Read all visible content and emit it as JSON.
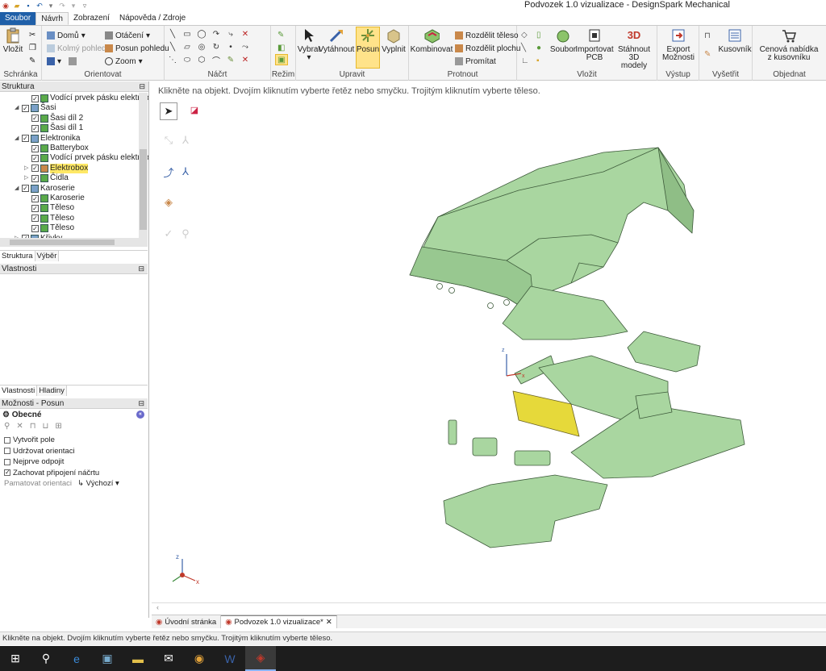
{
  "window": {
    "title": "Podvozek 1.0 vizualizace - DesignSpark Mechanical"
  },
  "ribbon_tabs": [
    "Soubor",
    "Návrh",
    "Zobrazení",
    "Nápověda / Zdroje"
  ],
  "groups": {
    "schranka": {
      "label": "Schránka",
      "paste": "Vložit"
    },
    "orientovat": {
      "label": "Orientovat",
      "home": "Domů",
      "kolmy": "Kolmý pohled",
      "otaceni": "Otáčení",
      "posun_pohledu": "Posun pohledu",
      "zoom": "Zoom"
    },
    "nacrt": {
      "label": "Náčrt"
    },
    "rezim": {
      "label": "Režim"
    },
    "upravit": {
      "label": "Upravit",
      "vybrat": "Vybrat",
      "vytahnout": "Vytáhnout",
      "posun": "Posun",
      "vyplnit": "Vyplnit"
    },
    "protnout": {
      "label": "Protnout",
      "kombinovat": "Kombinovat",
      "rozdelit_teleso": "Rozdělit těleso",
      "rozdelit_plochu": "Rozdělit plochu",
      "promitat": "Promítat"
    },
    "vlozit": {
      "label": "Vložit",
      "soubor": "Soubor",
      "importovat_pcb_1": "Importovat",
      "importovat_pcb_2": "PCB",
      "stahnout_1": "Stáhnout 3D",
      "stahnout_2": "modely"
    },
    "vystup": {
      "label": "Výstup",
      "export_1": "Export",
      "export_2": "Možnosti"
    },
    "vysetrit": {
      "label": "Vyšetřit",
      "kusovnik": "Kusovník"
    },
    "objednat": {
      "label": "Objednat",
      "cenova_1": "Cenová nabídka",
      "cenova_2": "z kusovníku"
    }
  },
  "structure_panel": {
    "title": "Struktura",
    "items": [
      {
        "label": "Vodící prvek pásku elektroboxu",
        "level": 2,
        "expander": "",
        "highlight": false
      },
      {
        "label": "Šasi",
        "level": 1,
        "expander": "◢",
        "highlight": false
      },
      {
        "label": "Šasi díl 2",
        "level": 2,
        "expander": "",
        "highlight": false
      },
      {
        "label": "Šasi díl 1",
        "level": 2,
        "expander": "",
        "highlight": false
      },
      {
        "label": "Elektronika",
        "level": 1,
        "expander": "◢",
        "highlight": false
      },
      {
        "label": "Batterybox",
        "level": 2,
        "expander": "",
        "highlight": false
      },
      {
        "label": "Vodící prvek pásku elektrob",
        "level": 2,
        "expander": "",
        "highlight": false
      },
      {
        "label": "Elektrobox",
        "level": 2,
        "expander": "▷",
        "highlight": true
      },
      {
        "label": "Čidla",
        "level": 2,
        "expander": "▷",
        "highlight": false
      },
      {
        "label": "Karoserie",
        "level": 1,
        "expander": "◢",
        "highlight": false
      },
      {
        "label": "Karoserie",
        "level": 2,
        "expander": "",
        "highlight": false
      },
      {
        "label": "Těleso",
        "level": 2,
        "expander": "",
        "highlight": false
      },
      {
        "label": "Těleso",
        "level": 2,
        "expander": "",
        "highlight": false
      },
      {
        "label": "Těleso",
        "level": 2,
        "expander": "",
        "highlight": false
      },
      {
        "label": "Křivky",
        "level": 1,
        "expander": "▷",
        "highlight": false
      }
    ],
    "tabs": [
      "Struktura",
      "Výběr"
    ]
  },
  "properties_panel": {
    "title": "Vlastnosti",
    "tabs": [
      "Vlastnosti",
      "Hladiny"
    ]
  },
  "options_panel": {
    "title": "Možnosti - Posun",
    "section": "Obecné",
    "options": [
      {
        "label": "Vytvořit pole",
        "checked": false
      },
      {
        "label": "Udržovat orientaci",
        "checked": false
      },
      {
        "label": "Nejprve odpojit",
        "checked": false
      },
      {
        "label": "Zachovat připojení náčrtu",
        "checked": true
      }
    ],
    "remember_label": "Pamatovat orientaci",
    "remember_value": "Výchozí"
  },
  "viewport": {
    "hint": "Klikněte na objekt.  Dvojím kliknutím vyberte řetěz nebo smyčku.  Trojitým kliknutím vyberte těleso."
  },
  "doc_tabs": [
    {
      "label": "Úvodní stránka",
      "active": false
    },
    {
      "label": "Podvozek 1.0 vizualizace*",
      "active": true
    }
  ],
  "status": {
    "text": "Klikněte na objekt.  Dvojím kliknutím vyberte řetěz nebo smyčku.  Trojitým kliknutím vyberte těleso."
  },
  "colors": {
    "model_fill": "#a9d6a0",
    "model_stroke": "#3d5a3a",
    "selected_fill": "#e6d93a",
    "accent": "#1f5fa8"
  },
  "axis_labels": {
    "z": "z",
    "x": "x"
  }
}
